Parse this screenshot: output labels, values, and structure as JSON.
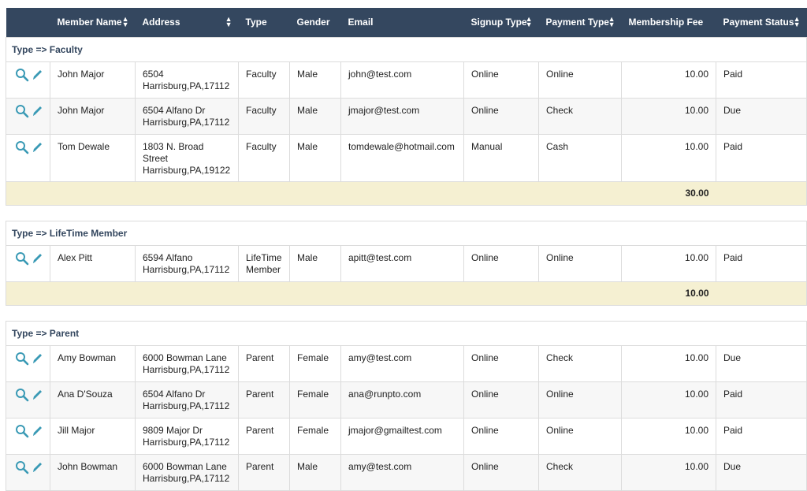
{
  "table": {
    "columns": [
      {
        "label": "",
        "sortable": false
      },
      {
        "label": "Member Name",
        "sortable": true
      },
      {
        "label": "Address",
        "sortable": true
      },
      {
        "label": "Type",
        "sortable": false
      },
      {
        "label": "Gender",
        "sortable": false
      },
      {
        "label": "Email",
        "sortable": false
      },
      {
        "label": "Signup Type",
        "sortable": true
      },
      {
        "label": "Payment Type",
        "sortable": true
      },
      {
        "label": "Membership Fee",
        "sortable": false
      },
      {
        "label": "Payment Status",
        "sortable": true
      }
    ],
    "groups": [
      {
        "label": "Type => Faculty",
        "rows": [
          {
            "name": "John Major",
            "address": [
              "6504",
              "Harrisburg,PA,17112"
            ],
            "type": "Faculty",
            "gender": "Male",
            "email": "john@test.com",
            "signup": "Online",
            "payment_type": "Online",
            "fee": "10.00",
            "status": "Paid"
          },
          {
            "name": "John Major",
            "address": [
              "6504 Alfano Dr",
              "Harrisburg,PA,17112"
            ],
            "type": "Faculty",
            "gender": "Male",
            "email": "jmajor@test.com",
            "signup": "Online",
            "payment_type": "Check",
            "fee": "10.00",
            "status": "Due"
          },
          {
            "name": "Tom Dewale",
            "address": [
              "1803 N. Broad",
              "Street",
              "Harrisburg,PA,19122"
            ],
            "type": "Faculty",
            "gender": "Male",
            "email": "tomdewale@hotmail.com",
            "signup": "Manual",
            "payment_type": "Cash",
            "fee": "10.00",
            "status": "Paid"
          }
        ],
        "total": "30.00"
      },
      {
        "label": "Type => LifeTime Member",
        "rows": [
          {
            "name": "Alex Pitt",
            "address": [
              "6594 Alfano",
              "Harrisburg,PA,17112"
            ],
            "type": "LifeTime Member",
            "gender": "Male",
            "email": "apitt@test.com",
            "signup": "Online",
            "payment_type": "Online",
            "fee": "10.00",
            "status": "Paid"
          }
        ],
        "total": "10.00"
      },
      {
        "label": "Type => Parent",
        "rows": [
          {
            "name": "Amy Bowman",
            "address": [
              "6000 Bowman Lane",
              "Harrisburg,PA,17112"
            ],
            "type": "Parent",
            "gender": "Female",
            "email": "amy@test.com",
            "signup": "Online",
            "payment_type": "Check",
            "fee": "10.00",
            "status": "Due"
          },
          {
            "name": "Ana D'Souza",
            "address": [
              "6504 Alfano Dr",
              "Harrisburg,PA,17112"
            ],
            "type": "Parent",
            "gender": "Female",
            "email": "ana@runpto.com",
            "signup": "Online",
            "payment_type": "Online",
            "fee": "10.00",
            "status": "Paid"
          },
          {
            "name": "Jill Major",
            "address": [
              "9809 Major Dr",
              "Harrisburg,PA,17112"
            ],
            "type": "Parent",
            "gender": "Female",
            "email": "jmajor@gmailtest.com",
            "signup": "Online",
            "payment_type": "Online",
            "fee": "10.00",
            "status": "Paid"
          },
          {
            "name": "John Bowman",
            "address": [
              "6000 Bowman Lane",
              "Harrisburg,PA,17112"
            ],
            "type": "Parent",
            "gender": "Male",
            "email": "amy@test.com",
            "signup": "Online",
            "payment_type": "Check",
            "fee": "10.00",
            "status": "Due"
          }
        ],
        "total": null
      }
    ]
  },
  "icons": {
    "view": "search-icon",
    "edit": "pencil-icon"
  },
  "colors": {
    "header_bg": "#34475f",
    "icon": "#3a9ab5",
    "total_bg": "#f5f0d2",
    "group_text": "#34475f"
  }
}
